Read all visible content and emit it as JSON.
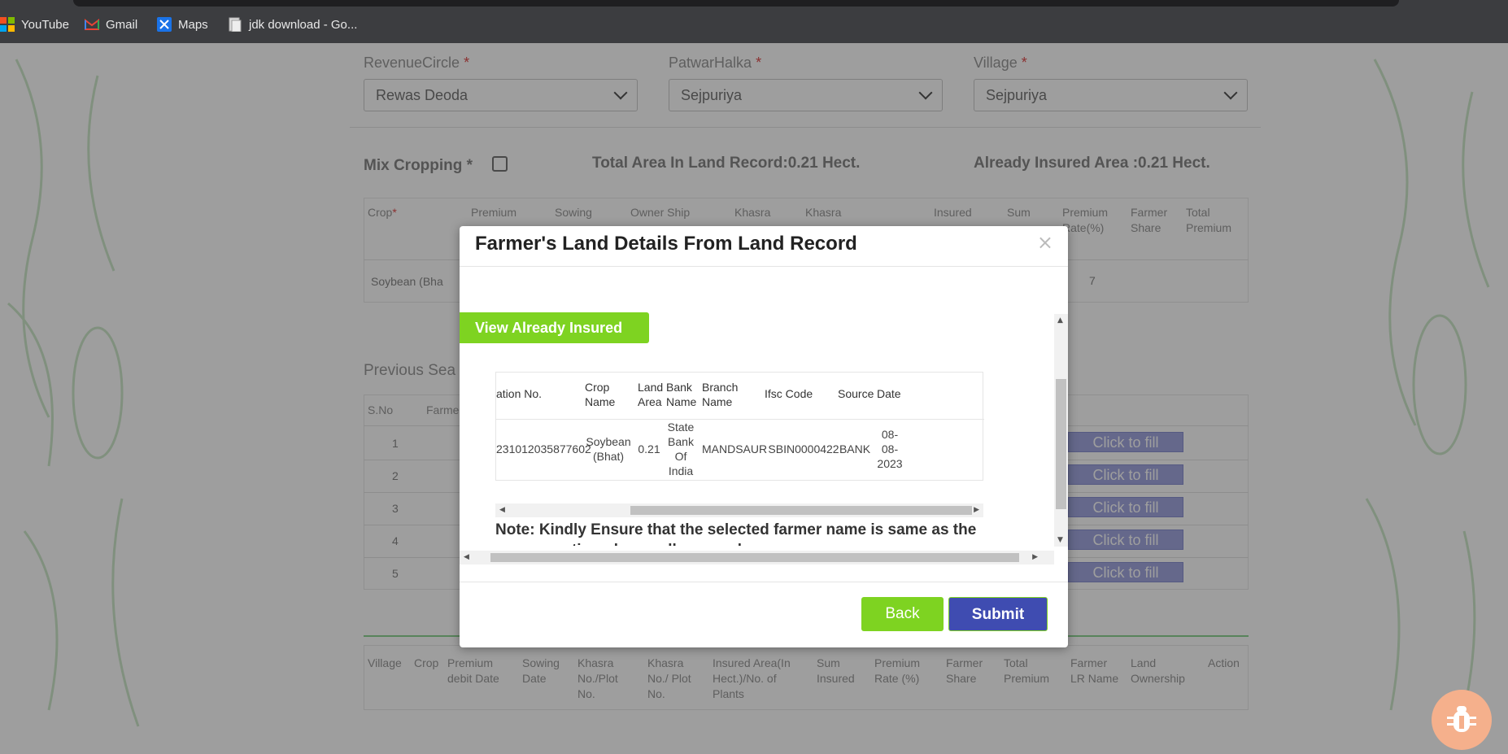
{
  "bookmarks": [
    {
      "label": "YouTube",
      "icon": "windows-grid-icon"
    },
    {
      "label": "Gmail",
      "icon": "gmail-icon"
    },
    {
      "label": "Maps",
      "icon": "maps-icon"
    },
    {
      "label": "jdk download - Go...",
      "icon": "document-icon"
    }
  ],
  "form": {
    "revenue_circle": {
      "label": "RevenueCircle",
      "required": "*",
      "value": "Rewas Deoda"
    },
    "patwar_halka": {
      "label": "PatwarHalka",
      "required": "*",
      "value": "Sejpuriya"
    },
    "village": {
      "label": "Village",
      "required": "*",
      "value": "Sejpuriya"
    },
    "mix_cropping": "Mix Cropping *",
    "total_area": "Total Area In Land Record:0.21 Hect.",
    "already_insured": "Already Insured Area :0.21 Hect."
  },
  "crop_table": {
    "headers": [
      "Crop",
      "Premium debit Date",
      "Sowing Date",
      "Owner Ship",
      "Khasra No./",
      "Khasra No./",
      "Insured Area",
      "Sum Insured",
      "Premium Rate(%)",
      "Farmer Share",
      "Total Premium"
    ],
    "crop_required": "*",
    "row": {
      "crop": "Soybean (Bha",
      "premium_rate": "7"
    }
  },
  "previous_season": {
    "title": "Previous Sea",
    "headers": [
      "S.No",
      "Farme"
    ],
    "rows": [
      "1",
      "2",
      "3",
      "4",
      "5"
    ],
    "fill_label": "Click to fill"
  },
  "bottom_table": {
    "headers": [
      "Village",
      "Crop",
      "Premium debit Date",
      "Sowing Date",
      "Khasra No./Plot No.",
      "Khasra No./ Plot No.",
      "Insured Area(In Hect.)/No. of Plants",
      "Sum Insured",
      "Premium Rate (%)",
      "Farmer Share",
      "Total Premium",
      "Farmer LR Name",
      "Land Ownership",
      "Action"
    ]
  },
  "modal": {
    "title": "Farmer's Land Details From Land Record",
    "close": "×",
    "view_insured_label": "View Already Insured",
    "table": {
      "headers": [
        "ation No.",
        "Crop Name",
        "Land Area",
        "Bank Name",
        "Branch Name",
        "Ifsc Code",
        "Source",
        "Date"
      ],
      "row": {
        "application_no": "231012035877602",
        "crop_name": "Soybean (Bhat)",
        "land_area": "0.21",
        "bank_name": "State Bank Of India",
        "branch_name": "MANDSAUR",
        "ifsc_code": "SBIN0000422",
        "source": "BANK",
        "date": "08-08-2023"
      }
    },
    "note": "Note: Kindly Ensure that the selected farmer name is same as the name mentioned on aadhaar card",
    "back_label": "Back",
    "submit_label": "Submit"
  },
  "colors": {
    "green": "#7ed321",
    "submit_blue": "#3f4cb1",
    "fill_button": "#a4a8e0"
  }
}
